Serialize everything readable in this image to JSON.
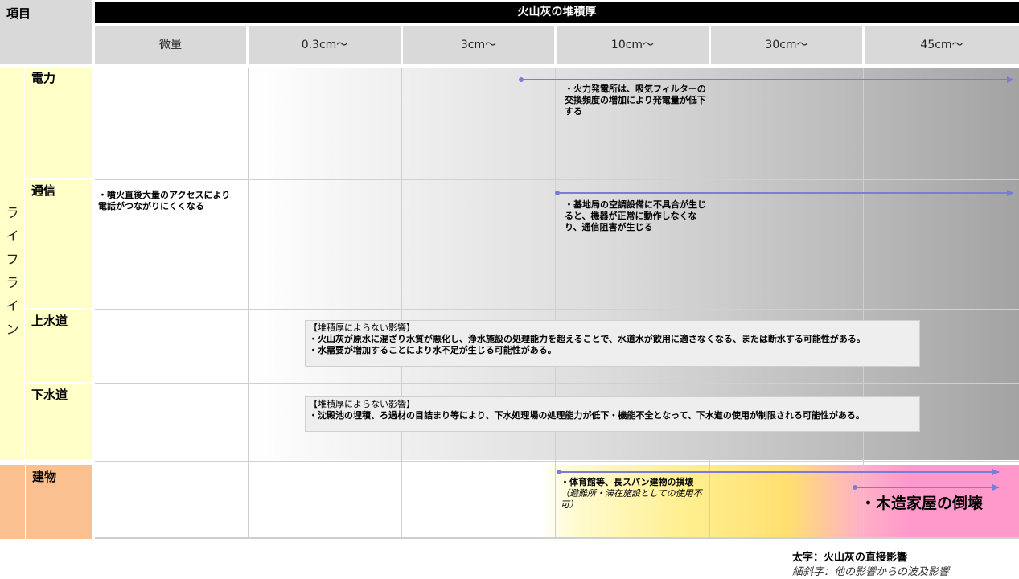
{
  "header": {
    "item_label": "項目",
    "title": "火山灰の堆積厚",
    "columns": [
      "微量",
      "0.3cm〜",
      "3cm〜",
      "10cm〜",
      "30cm〜",
      "45cm〜"
    ]
  },
  "categories": {
    "lifeline": "ライフライン",
    "power": "電力",
    "telecom": "通信",
    "water": "上水道",
    "sewer": "下水道",
    "building": "建物"
  },
  "notes": {
    "power": "・火力発電所は、吸気フィルターの交換頻度の増加により発電量が低下する",
    "telecom_trace": "・噴火直後大量のアクセスにより電話がつながりにくくなる",
    "telecom_10": "・基地局の空調設備に不具合が生じると、機器が正常に動作しなくなり、通信阻害が生じる",
    "water_head": "【堆積厚によらない影響】",
    "water_1": "・火山灰が原水に混ざり水質が悪化し、浄水施設の処理能力を超えることで、水道水が飲用に適さなくなる、または断水する可能性がある。",
    "water_2": "・水需要が増加することにより水不足が生じる可能性がある。",
    "sewer_head": "【堆積厚によらない影響】",
    "sewer_1": "・沈殿池の埋積、ろ過材の目詰まり等により、下水処理場の処理能力が低下・機能不全となって、下水道の使用が制限される可能性がある。",
    "bld_1": "・体育館等、長スパン建物の損壊",
    "bld_1_sub": "（避難所・滞在施設としての使用不可）",
    "bld_2": "・木造家屋の倒壊"
  },
  "legend": {
    "bold": "太字：火山灰の直接影響",
    "italic": "細斜字：他の影響からの波及影響"
  },
  "colors": {
    "arrow": "#7b7bd9",
    "header_black": "#000000",
    "lifeline_bg": "#ffffc8",
    "building_bg": "#fac08f",
    "pink": "#ff99cc"
  }
}
